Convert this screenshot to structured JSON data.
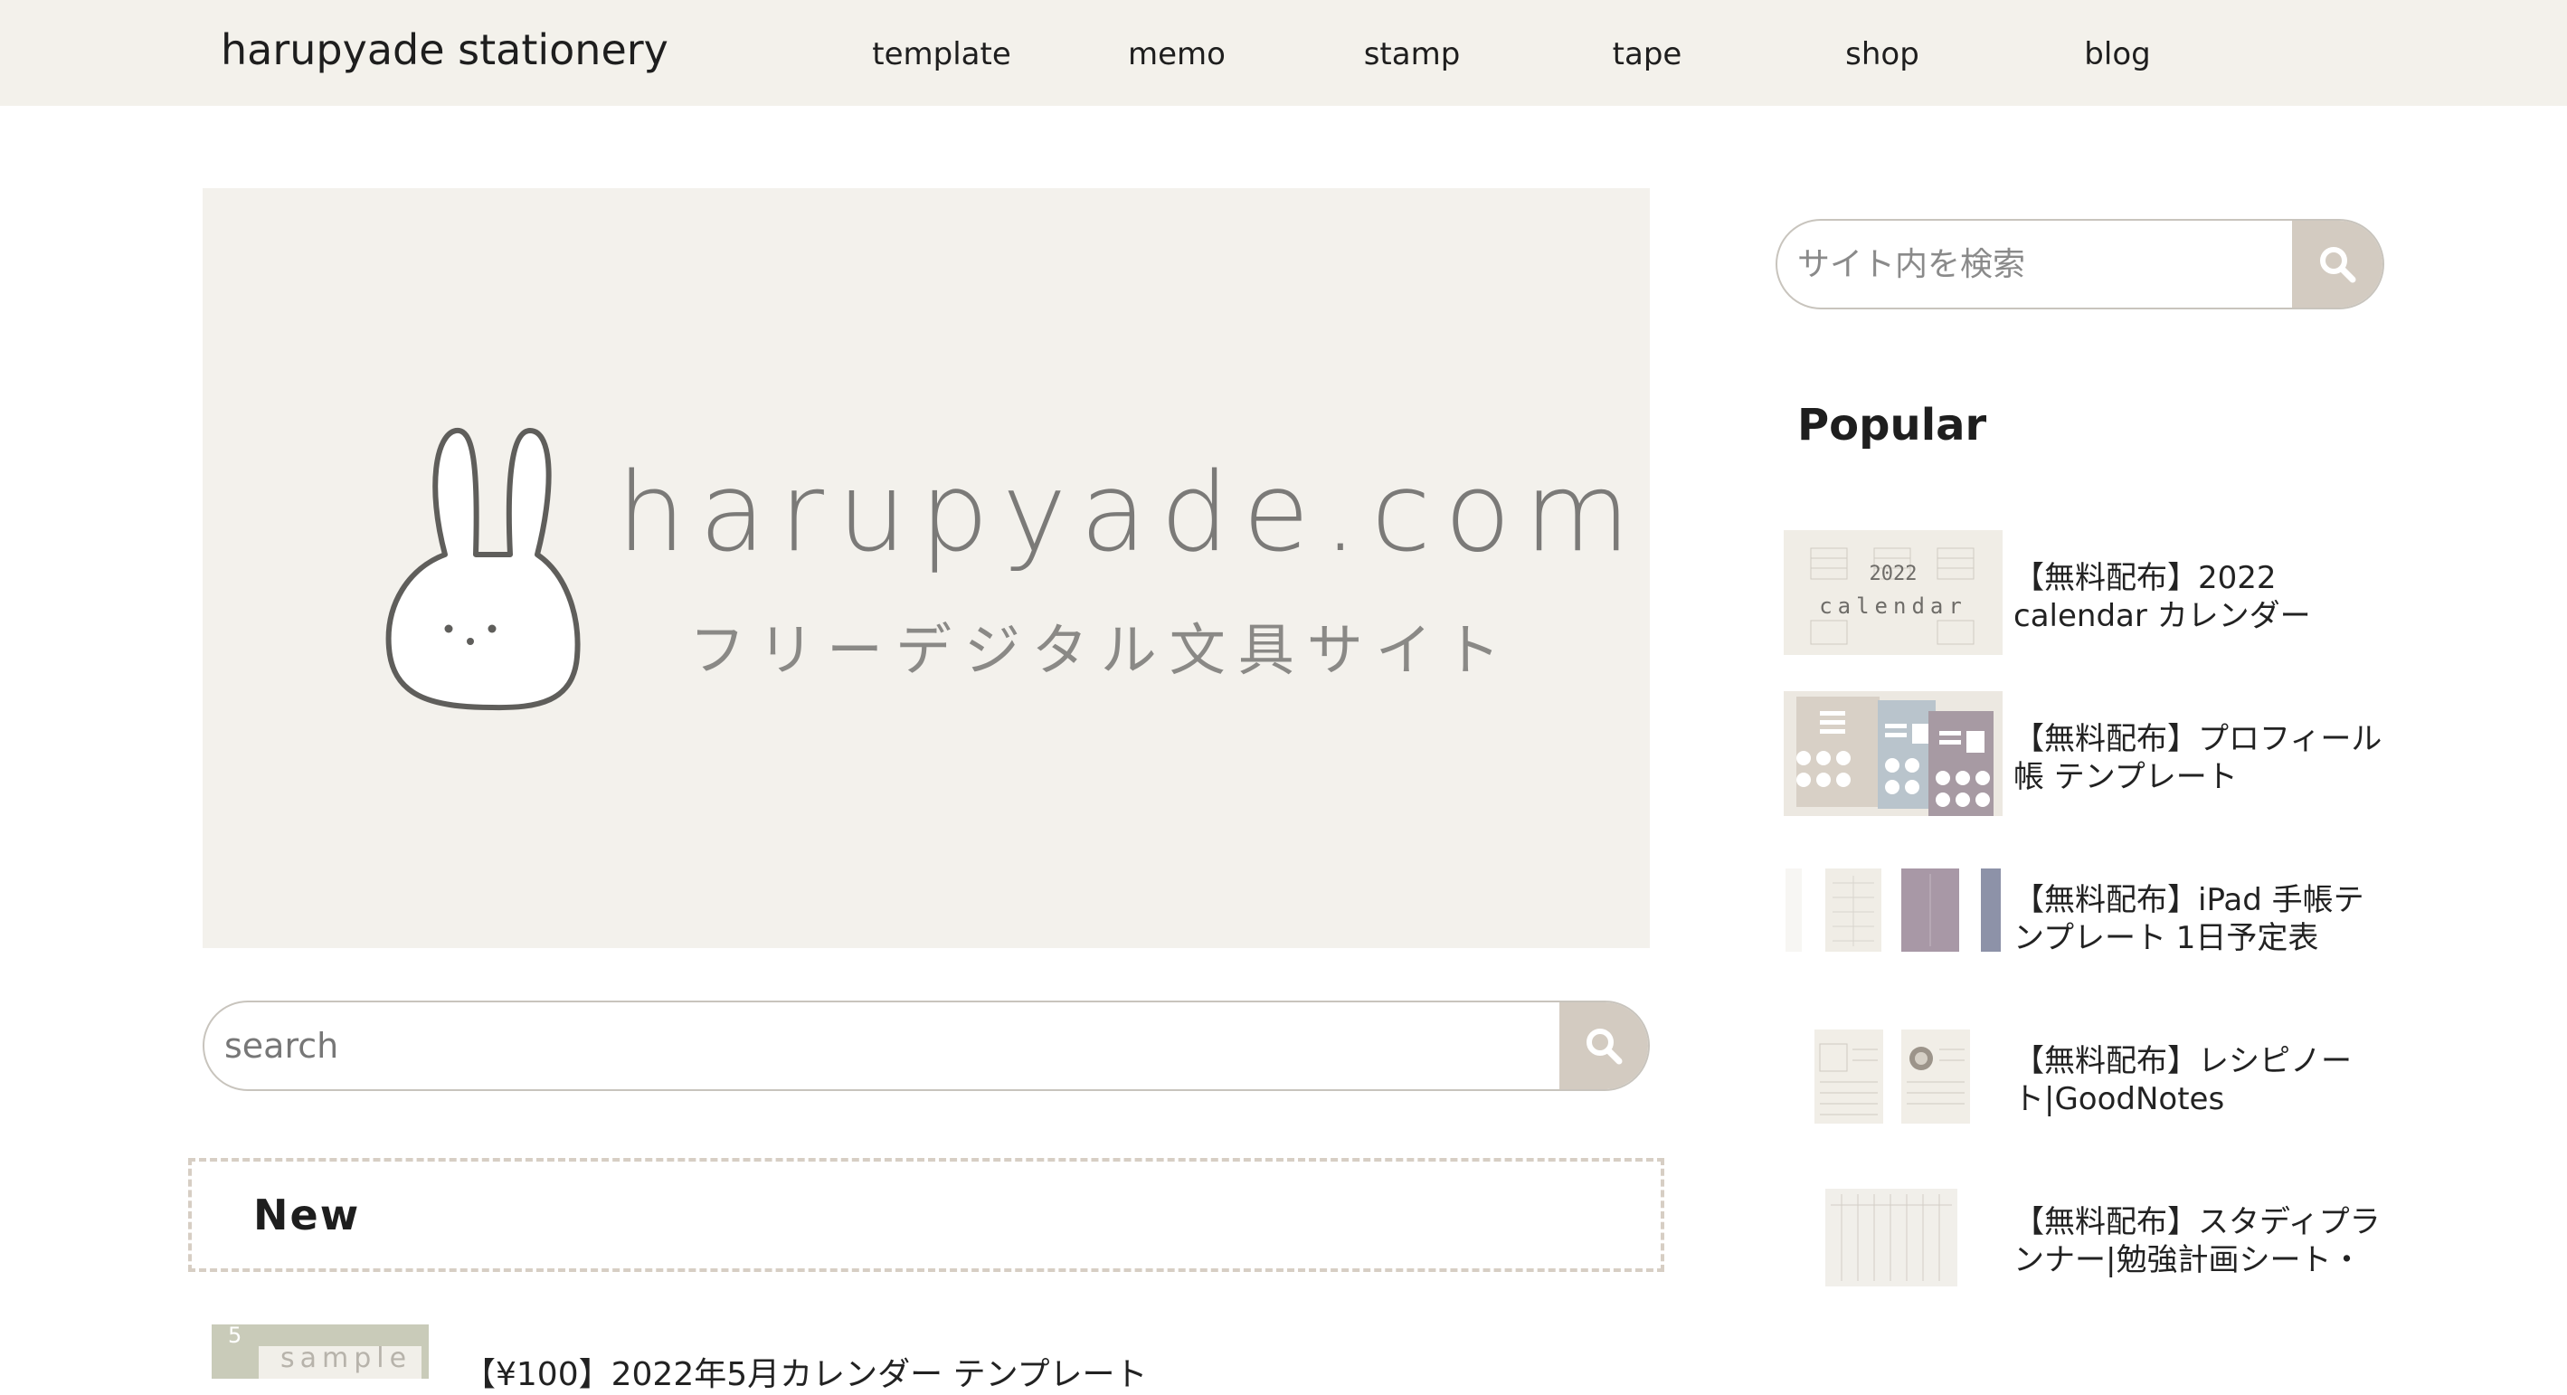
{
  "header": {
    "site_title": "harupyade stationery",
    "nav": [
      "template",
      "memo",
      "stamp",
      "tape",
      "shop",
      "blog"
    ]
  },
  "hero": {
    "domain": "harupyade.com",
    "tagline": "フリーデジタル文具サイト"
  },
  "main_search": {
    "placeholder": "search"
  },
  "new_section": {
    "heading": "New",
    "items": [
      {
        "thumb_month": "5",
        "thumb_text": "sample",
        "title": "【¥100】2022年5月カレンダー テンプレート"
      }
    ]
  },
  "sidebar": {
    "search_placeholder": "サイト内を検索",
    "popular_heading": "Popular",
    "popular": [
      {
        "title": "【無料配布】2022 calendar カレンダー",
        "thumb_year": "2022",
        "thumb_word": "calendar"
      },
      {
        "title": "【無料配布】プロフィール帳 テンプレート"
      },
      {
        "title": "【無料配布】iPad 手帳テンプレート 1日予定表"
      },
      {
        "title": "【無料配布】レシピノート|GoodNotes"
      },
      {
        "title": "【無料配布】スタディプランナー|勉強計画シート・"
      }
    ]
  },
  "colors": {
    "header_bg": "#f3f1eb",
    "hero_bg": "#f3f1ec",
    "search_button": "#d3cbc1",
    "dashed_border": "#d7cec4"
  },
  "icons": [
    "search-icon",
    "bunny-logo-icon"
  ]
}
